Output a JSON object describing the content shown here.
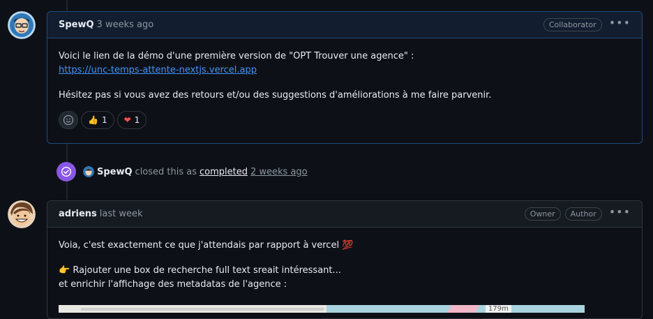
{
  "comments": [
    {
      "author": "SpewQ",
      "time": "3 weeks ago",
      "badges": [
        "Collaborator"
      ],
      "body": {
        "p1_text": "Voici le lien de la démo d'une première version de \"OPT Trouver une agence\" :",
        "link": "https://unc-temps-attente-nextjs.vercel.app",
        "p2_text": "Hésitez pas si vous avez des retours et/ou des suggestions d'améliorations à me faire parvenir."
      },
      "reactions": [
        {
          "emoji": "👍",
          "count": "1"
        },
        {
          "emoji": "❤",
          "count": "1"
        }
      ]
    },
    {
      "author": "adriens",
      "time": "last week",
      "badges": [
        "Owner",
        "Author"
      ],
      "body": {
        "p1_text": "Voia, c'est exactement ce que j'attendais par rapport à vercel",
        "p1_emoji": "💯",
        "p2_emoji": "👉",
        "p2_line1": "Rajouter une box de recherche full text sreait intéressant...",
        "p2_line2": "et enrichir l'affichage des metadatas de l'agence :"
      }
    }
  ],
  "event": {
    "actor": "SpewQ",
    "action": "closed this as",
    "state": "completed",
    "time": "2 weeks ago"
  },
  "map_preview": {
    "scale_label": "179m"
  },
  "colors": {
    "background": "#0d1117",
    "accent_link": "#4493f8",
    "closed_purple": "#8957e5",
    "heart_red": "#f85149"
  }
}
